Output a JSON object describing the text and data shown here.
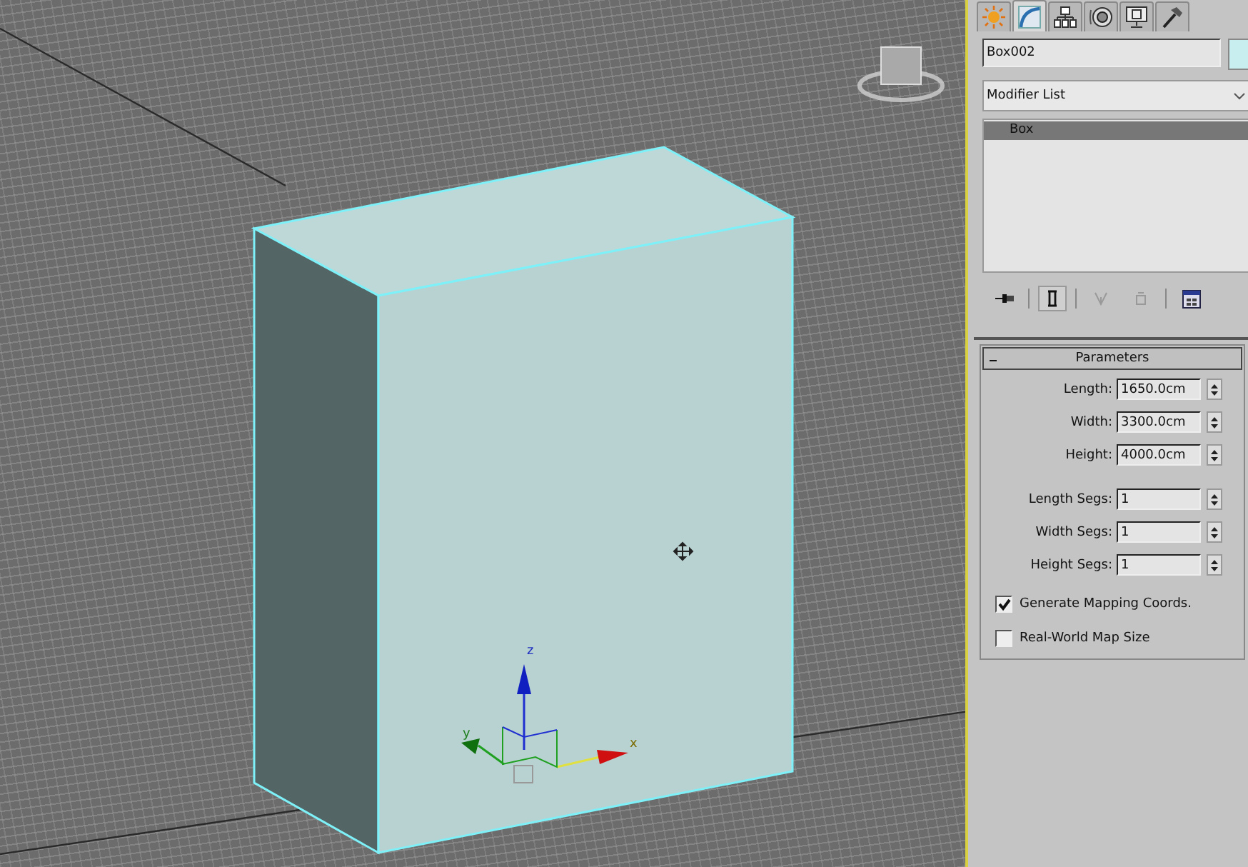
{
  "viewport": {
    "gizmo_labels": [
      "z",
      "y",
      "x"
    ]
  },
  "command_panel": {
    "tabs": [
      {
        "kind": "create",
        "selected": false
      },
      {
        "kind": "modify",
        "selected": true
      },
      {
        "kind": "hierarchy",
        "selected": false
      },
      {
        "kind": "motion",
        "selected": false
      },
      {
        "kind": "display",
        "selected": false
      },
      {
        "kind": "utilities",
        "selected": false
      }
    ],
    "object_name": "Box002",
    "modifier_list": "Modifier List",
    "stack": [
      {
        "label": "Box",
        "selected": true
      }
    ],
    "rollout": {
      "title": "Parameters",
      "expanded": true,
      "dimension_fields": [
        {
          "label": "Length:",
          "value": "1650.0cm"
        },
        {
          "label": "Width:",
          "value": "3300.0cm"
        },
        {
          "label": "Height:",
          "value": "4000.0cm"
        }
      ],
      "segment_fields": [
        {
          "label": "Length Segs:",
          "value": "1"
        },
        {
          "label": "Width Segs:",
          "value": "1"
        },
        {
          "label": "Height Segs:",
          "value": "1"
        }
      ],
      "checkboxes": [
        {
          "label": "Generate Mapping Coords.",
          "checked": true
        },
        {
          "label": "Real-World Map Size",
          "checked": false
        }
      ]
    }
  }
}
